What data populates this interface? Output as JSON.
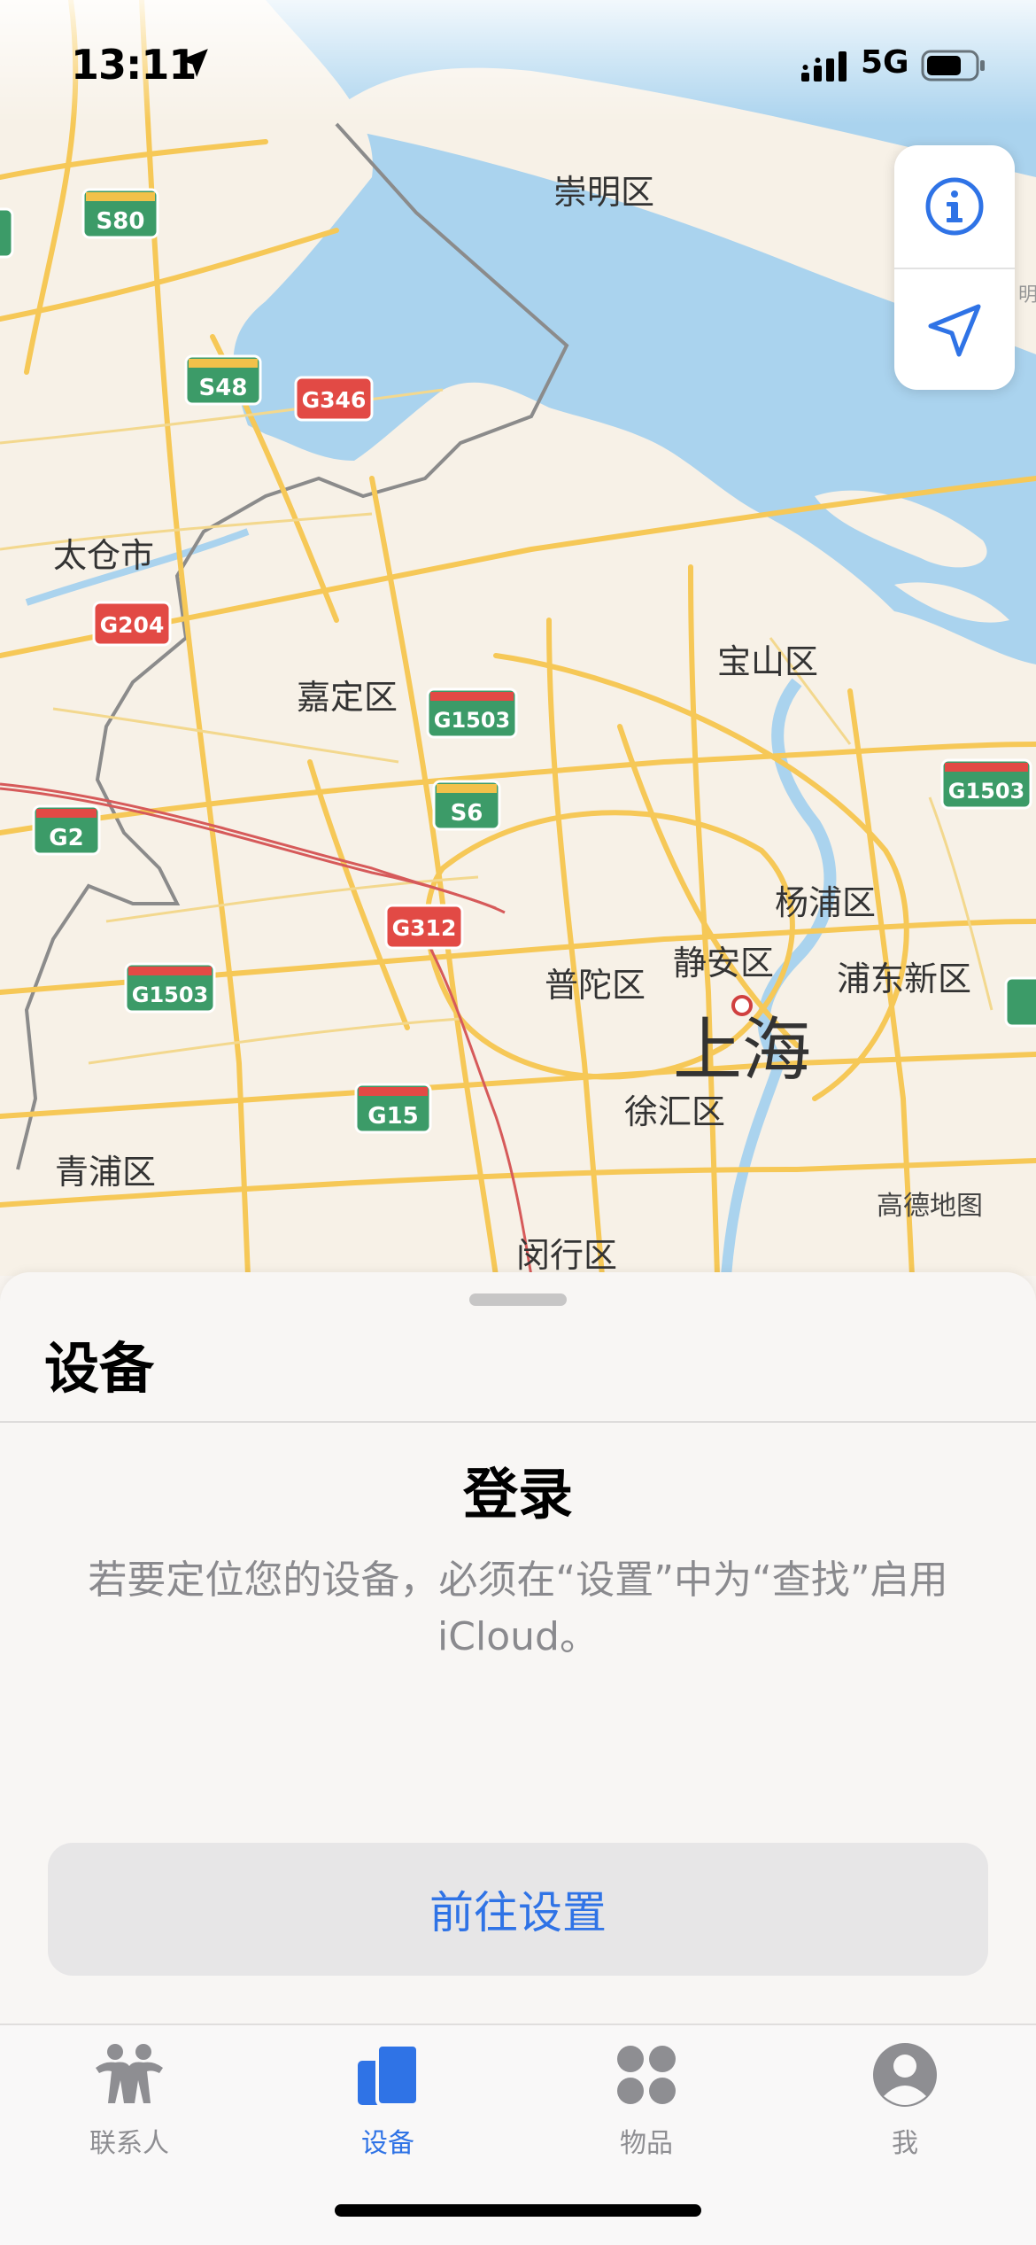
{
  "status_bar": {
    "time": "13:11",
    "network": "5G"
  },
  "map": {
    "labels": {
      "chongming": "崇明区",
      "taicang": "太仓市",
      "baoshan": "宝山区",
      "jiading": "嘉定区",
      "yangpu": "杨浦区",
      "jingan": "静安区",
      "putuo": "普陀区",
      "pudong": "浦东新区",
      "shanghai": "上海",
      "xuhui": "徐汇区",
      "qingpu": "青浦区",
      "minhang": "闵行区"
    },
    "shields": {
      "s80": "S80",
      "s48": "S48",
      "g346": "G346",
      "g204": "G204",
      "g1503_a": "G1503",
      "s6": "S6",
      "g1503_b": "G1503",
      "g2": "G2",
      "g312": "G312",
      "g1503_c": "G1503",
      "g15": "G15"
    },
    "attribution": "高德地图",
    "colors": {
      "water": "#aad3ee",
      "land": "#f7f1e7",
      "road": "#f7cf5e",
      "green_shield": "#3c9b68",
      "red_shield": "#e24a45"
    }
  },
  "sheet": {
    "title": "设备",
    "login_title": "登录",
    "login_description": "若要定位您的设备，必须在“设置”中为“查找”启用 iCloud。",
    "settings_button": "前往设置"
  },
  "tabs": [
    {
      "label": "联系人",
      "icon": "people-icon",
      "active": false
    },
    {
      "label": "设备",
      "icon": "devices-icon",
      "active": true
    },
    {
      "label": "物品",
      "icon": "items-icon",
      "active": false
    },
    {
      "label": "我",
      "icon": "person-circle-icon",
      "active": false
    }
  ],
  "accent_color": "#2f73e6"
}
